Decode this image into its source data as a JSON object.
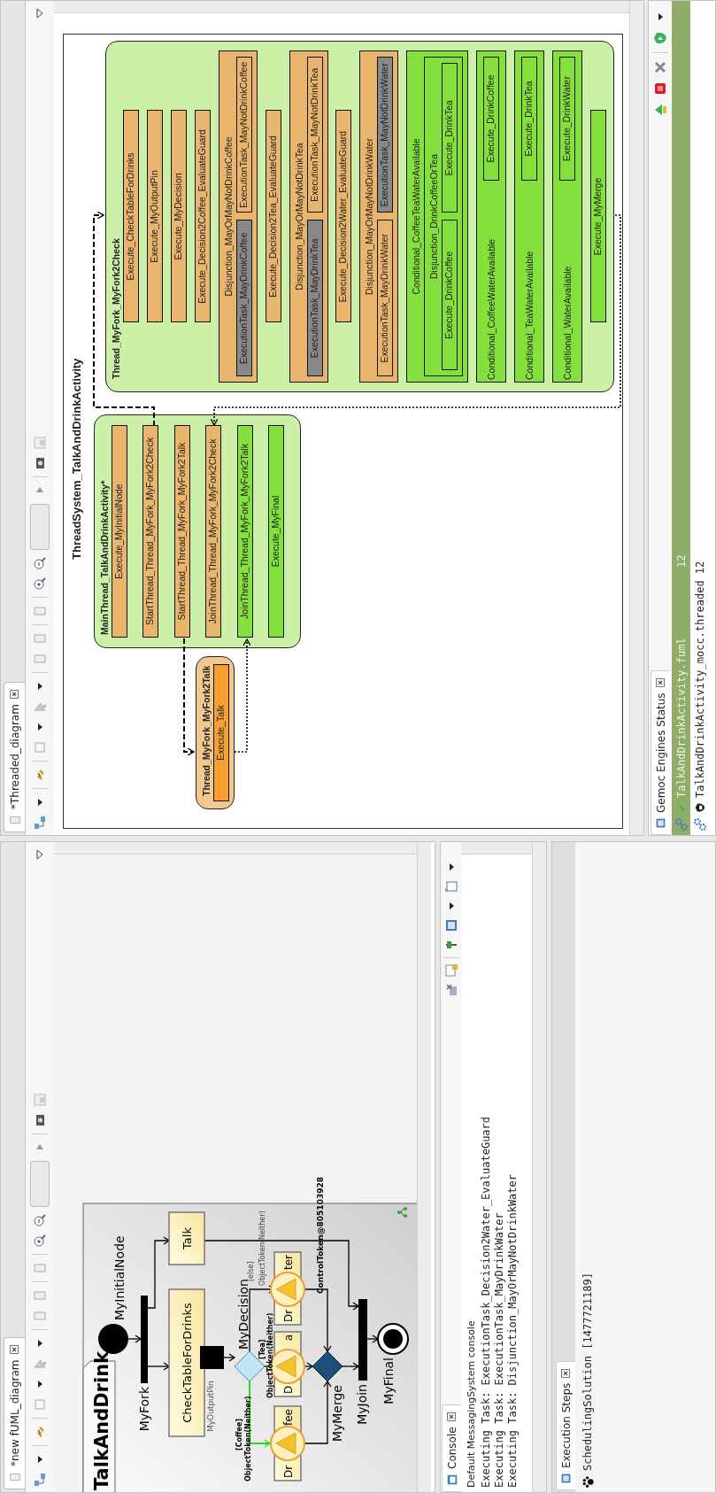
{
  "editors": [
    {
      "tab": "*new fUML_diagram"
    },
    {
      "tab": "*Threaded_diagram"
    }
  ],
  "activity_diagram": {
    "title": "TalkAndDrink",
    "nodes": [
      {
        "kind": "initial",
        "label": "MyInitialNode"
      },
      {
        "kind": "fork",
        "label": "MyFork"
      },
      {
        "kind": "action",
        "label": "CheckTableForDrinks"
      },
      {
        "kind": "action",
        "label": "Talk"
      },
      {
        "kind": "pin",
        "label": "MyOutputPin"
      },
      {
        "kind": "decision",
        "label": "MyDecision"
      },
      {
        "kind": "action_token",
        "label_parts": [
          "Dr",
          "fee"
        ]
      },
      {
        "kind": "action_token",
        "label_parts": [
          "D",
          "a"
        ]
      },
      {
        "kind": "action_token",
        "label_parts": [
          "Dr",
          "ter"
        ]
      },
      {
        "kind": "merge",
        "label": "MyMerge"
      },
      {
        "kind": "join",
        "label": "MyJoin"
      },
      {
        "kind": "final",
        "label": "MyFinal"
      }
    ],
    "edge_labels": [
      {
        "text": "[Coffee]",
        "active": true
      },
      {
        "text": "ObjectToken(Neither)",
        "active": true
      },
      {
        "text": "[Tea]",
        "active": true
      },
      {
        "text": "ObjectToken(Neither)",
        "active": true
      },
      {
        "text": "[else]",
        "active": false
      },
      {
        "text": "ObjectToken(Neither)",
        "active": false
      },
      {
        "text": "ControlToken@805103928",
        "active": true
      }
    ],
    "edges": [
      {
        "highlighted": false
      },
      {
        "highlighted": false
      },
      {
        "highlighted": false
      },
      {
        "highlighted": false
      },
      {
        "highlighted": true
      },
      {
        "highlighted": false
      },
      {
        "highlighted": false
      },
      {
        "highlighted": false
      },
      {
        "highlighted": false
      },
      {
        "highlighted": false
      },
      {
        "highlighted": false
      },
      {
        "highlighted": false
      },
      {
        "highlighted": false
      }
    ]
  },
  "console": {
    "tab": "Console",
    "title": "Default MessagingSystem console",
    "lines": [
      "Executing Task: ExecutionTask_Decision2Water_EvaluateGuard",
      "Executing Task: ExecutionTask_MayDrinkWater",
      "Executing Task: Disjunction_MayOrMayNotDrinkWater"
    ]
  },
  "execution_steps": {
    "tab": "Execution Steps",
    "items": [
      {
        "label": "SchedulingSolution [1477721189]"
      }
    ]
  },
  "thread_diagram": {
    "title": "ThreadSystem_TalkAndDrinkActivity",
    "threads": [
      {
        "title": "MainThread_TalkAndDrinkActivity*",
        "color": "#ccf0a8",
        "items": [
          {
            "kind": "task",
            "label": "Execute_MyInitialNode",
            "color": "#e9b56c"
          },
          {
            "kind": "task",
            "label": "StartThread_Thread_MyFork_MyFork2Check",
            "color": "#e9b56c"
          },
          {
            "kind": "task",
            "label": "StartThread_Thread_MyFork_MyFork2Talk",
            "color": "#e9b56c"
          },
          {
            "kind": "task",
            "label": "JoinThread_Thread_MyFork_MyFork2Check",
            "color": "#e9b56c"
          },
          {
            "kind": "task",
            "label": "JoinThread_Thread_MyFork_MyFork2Talk",
            "color": "#84e03c"
          },
          {
            "kind": "task",
            "label": "Execute_MyFinal",
            "color": "#84e03c"
          }
        ]
      },
      {
        "title": "Thread_MyFork_MyFork2Talk",
        "color": "#f0c890",
        "items": [
          {
            "kind": "task",
            "label": "Execute_Talk",
            "color": "#f6a032"
          }
        ]
      },
      {
        "title": "Thread_MyFork_MyFork2Check",
        "color": "#ccf0a8",
        "items": [
          {
            "kind": "task",
            "label": "Execute_CheckTableForDrinks",
            "color": "#e9b56c"
          },
          {
            "kind": "task",
            "label": "Execute_MyOutputPin",
            "color": "#e9b56c"
          },
          {
            "kind": "task",
            "label": "Execute_MyDecision",
            "color": "#e9b56c"
          },
          {
            "kind": "task",
            "label": "Execute_Decision2Coffee_EvaluateGuard",
            "color": "#e9b56c"
          },
          {
            "kind": "group",
            "label": "Disjunction_MayOrMayNotDrinkCoffee",
            "color": "#e9b56c",
            "children": [
              {
                "kind": "task",
                "label": "ExecutionTask_MayDrinkCoffee",
                "color": "#888888"
              },
              {
                "kind": "task",
                "label": "ExecutionTask_MayNotDrinkCoffee",
                "color": "#e9b56c"
              }
            ]
          },
          {
            "kind": "task",
            "label": "Execute_Decision2Tea_EvaluateGuard",
            "color": "#e9b56c"
          },
          {
            "kind": "group",
            "label": "Disjunction_MayOrMayNotDrinkTea",
            "color": "#e9b56c",
            "children": [
              {
                "kind": "task",
                "label": "ExecutionTask_MayDrinkTea",
                "color": "#888888"
              },
              {
                "kind": "task",
                "label": "ExecutionTask_MayNotDrinkTea",
                "color": "#e9b56c"
              }
            ]
          },
          {
            "kind": "task",
            "label": "Execute_Decision2Water_EvaluateGuard",
            "color": "#e9b56c"
          },
          {
            "kind": "group",
            "label": "Disjunction_MayOrMayNotDrinkWater",
            "color": "#e9b56c",
            "children": [
              {
                "kind": "task",
                "label": "ExecutionTask_MayDrinkWater",
                "color": "#e9b56c"
              },
              {
                "kind": "task",
                "label": "ExecutionTask_MayNotDrinkWater",
                "color": "#888888"
              }
            ]
          },
          {
            "kind": "group",
            "label": "Conditional_CoffeeTeaWaterAvailable",
            "color": "#84e03c",
            "children": [
              {
                "kind": "group",
                "label": "Disjunction_DrinkCoffeeOrTea",
                "color": "#84e03c",
                "children": [
                  {
                    "kind": "task",
                    "label": "Execute_DrinkCoffee",
                    "color": "#84e03c"
                  },
                  {
                    "kind": "task",
                    "label": "Execute_DrinkTea",
                    "color": "#84e03c"
                  }
                ]
              }
            ]
          },
          {
            "kind": "inline_group",
            "label": "Conditional_CoffeeWaterAvailable",
            "color": "#84e03c",
            "children": [
              {
                "kind": "task",
                "label": "Execute_DrinkCoffee",
                "color": "#84e03c"
              }
            ]
          },
          {
            "kind": "inline_group",
            "label": "Conditional_TeaWaterAvailable",
            "color": "#84e03c",
            "children": [
              {
                "kind": "task",
                "label": "Execute_DrinkTea",
                "color": "#84e03c"
              }
            ]
          },
          {
            "kind": "inline_group",
            "label": "Conditional_WaterAvailable",
            "color": "#84e03c",
            "children": [
              {
                "kind": "task",
                "label": "Execute_DrinkWater",
                "color": "#84e03c"
              }
            ]
          },
          {
            "kind": "task",
            "label": "Execute_MyMerge",
            "color": "#84e03c"
          }
        ]
      }
    ]
  },
  "engines_panel": {
    "tab": "Gemoc Engines Status",
    "engines": [
      {
        "label": "TalkAndDrinkActivity.fuml",
        "count": "12",
        "selected": true
      },
      {
        "label": "TalkAndDrinkActivity_mocc.threaded 12",
        "selected": false
      }
    ]
  }
}
